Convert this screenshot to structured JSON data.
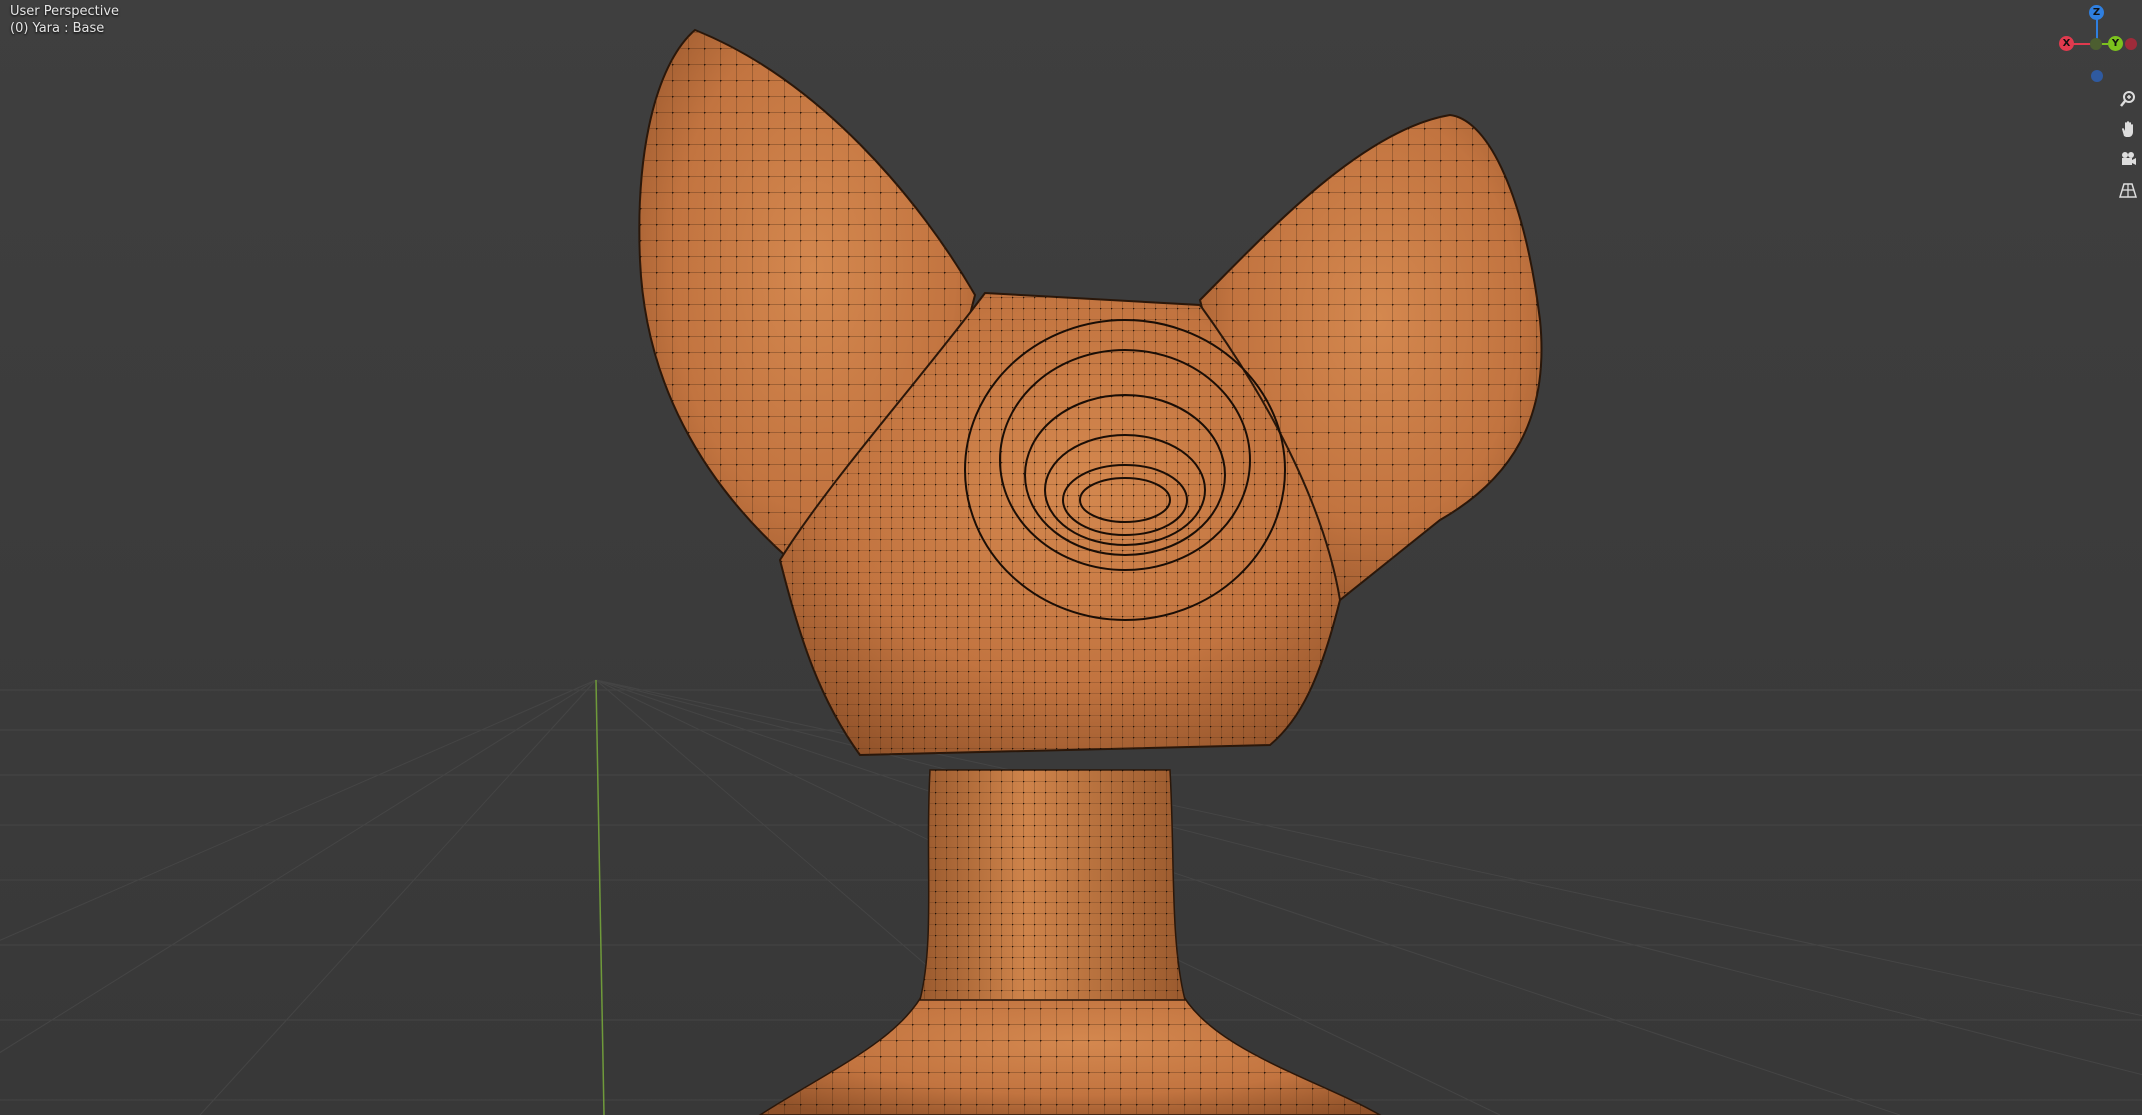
{
  "viewport": {
    "view_name": "User Perspective",
    "object_info": "(0) Yara  : Base",
    "background_color": "#3d3d3d",
    "mesh_color": "#c97a44"
  },
  "gizmo": {
    "axes": [
      {
        "label": "Z",
        "color": "#2f7fe0"
      },
      {
        "label": "Y",
        "color": "#7cc21e"
      },
      {
        "label": "X",
        "color": "#e03a4e"
      }
    ],
    "negative_axis_colors": [
      "#9e2b3a",
      "#4c5e30",
      "#2f5aa0"
    ]
  },
  "nav_tools": [
    {
      "icon": "zoom-icon"
    },
    {
      "icon": "hand-pan-icon"
    },
    {
      "icon": "camera-icon"
    },
    {
      "icon": "grid-view-icon"
    }
  ]
}
